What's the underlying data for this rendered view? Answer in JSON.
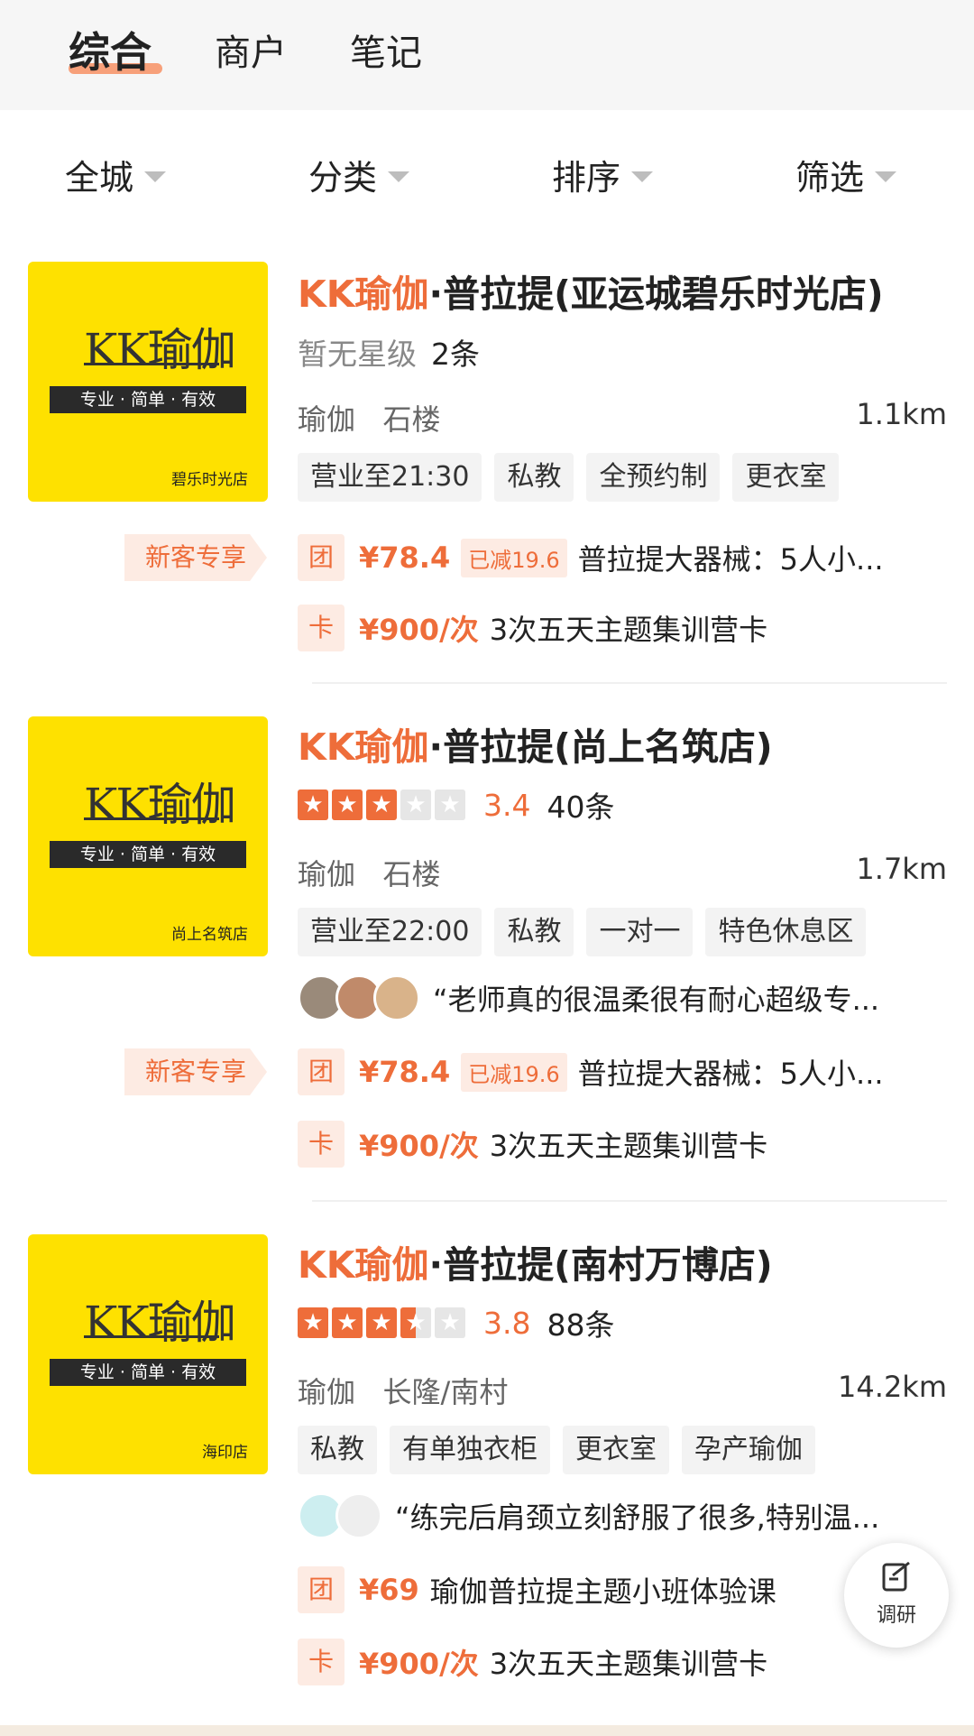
{
  "tabs": [
    {
      "label": "综合",
      "active": true
    },
    {
      "label": "商户",
      "active": false
    },
    {
      "label": "笔记",
      "active": false
    }
  ],
  "filters": [
    "全城",
    "分类",
    "排序",
    "筛选"
  ],
  "colors": {
    "accent": "#ee6d3a",
    "thumb_bg": "#fee100"
  },
  "listings": [
    {
      "logo": "KK瑜伽",
      "slogan": "专业 · 简单 · 有效",
      "store_label": "碧乐时光店",
      "brand": "KK瑜伽",
      "title_rest": "·普拉提(亚运城碧乐时光店)",
      "rating_text": "暂无星级",
      "review_count": "2条",
      "category": "瑜伽",
      "area": "石楼",
      "distance": "1.1km",
      "tags": [
        "营业至21:30",
        "私教",
        "全预约制",
        "更衣室"
      ],
      "new_badge": "新客专享",
      "deals": [
        {
          "icon": "团",
          "price": "¥78.4",
          "discount": "已减19.6",
          "text": "普拉提大器械：5人小..."
        },
        {
          "icon": "卡",
          "price": "¥900/次",
          "text": "3次五天主题集训营卡"
        }
      ]
    },
    {
      "logo": "KK瑜伽",
      "slogan": "专业 · 简单 · 有效",
      "store_label": "尚上名筑店",
      "brand": "KK瑜伽",
      "title_rest": "·普拉提(尚上名筑店)",
      "stars": 3.0,
      "score": "3.4",
      "review_count": "40条",
      "category": "瑜伽",
      "area": "石楼",
      "distance": "1.7km",
      "tags": [
        "营业至22:00",
        "私教",
        "一对一",
        "特色休息区"
      ],
      "review_quote": "“老师真的很温柔很有耐心超级专...",
      "new_badge": "新客专享",
      "deals": [
        {
          "icon": "团",
          "price": "¥78.4",
          "discount": "已减19.6",
          "text": "普拉提大器械：5人小..."
        },
        {
          "icon": "卡",
          "price": "¥900/次",
          "text": "3次五天主题集训营卡"
        }
      ]
    },
    {
      "logo": "KK瑜伽",
      "slogan": "专业 · 简单 · 有效",
      "store_label": "海印店",
      "brand": "KK瑜伽",
      "title_rest": "·普拉提(南村万博店)",
      "stars": 3.5,
      "score": "3.8",
      "review_count": "88条",
      "category": "瑜伽",
      "area": "长隆/南村",
      "distance": "14.2km",
      "tags": [
        "私教",
        "有单独衣柜",
        "更衣室",
        "孕产瑜伽"
      ],
      "review_quote": "“练完后肩颈立刻舒服了很多,特别温...",
      "deals": [
        {
          "icon": "团",
          "price": "¥69",
          "text": "瑜伽普拉提主题小班体验课"
        },
        {
          "icon": "卡",
          "price": "¥900/次",
          "text": "3次五天主题集训营卡"
        }
      ]
    }
  ],
  "survey_button": {
    "label": "调研",
    "icon": "edit-note-icon"
  }
}
